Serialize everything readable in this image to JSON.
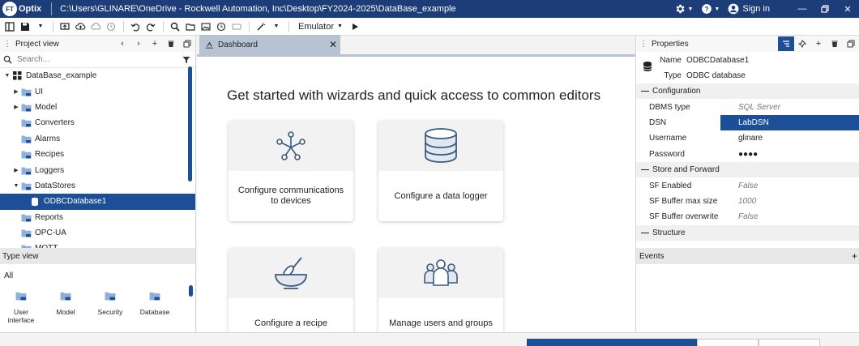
{
  "titlebar": {
    "logo_badge": "FT",
    "logo_text": "Optix",
    "path": "C:\\Users\\GLINARE\\OneDrive - Rockwell Automation, Inc\\Desktop\\FY2024-2025\\DataBase_example",
    "signin_label": "Sign in"
  },
  "toolbar": {
    "emulator_label": "Emulator"
  },
  "project_view": {
    "title": "Project view",
    "search_placeholder": "Search...",
    "items": [
      {
        "label": "DataBase_example",
        "level": 0,
        "arrow": "down"
      },
      {
        "label": "UI",
        "level": 1,
        "arrow": "right"
      },
      {
        "label": "Model",
        "level": 1,
        "arrow": "right"
      },
      {
        "label": "Converters",
        "level": 1,
        "arrow": ""
      },
      {
        "label": "Alarms",
        "level": 1,
        "arrow": ""
      },
      {
        "label": "Recipes",
        "level": 1,
        "arrow": ""
      },
      {
        "label": "Loggers",
        "level": 1,
        "arrow": "right"
      },
      {
        "label": "DataStores",
        "level": 1,
        "arrow": "down"
      },
      {
        "label": "ODBCDatabase1",
        "level": 2,
        "arrow": "",
        "selected": true
      },
      {
        "label": "Reports",
        "level": 1,
        "arrow": ""
      },
      {
        "label": "OPC-UA",
        "level": 1,
        "arrow": ""
      },
      {
        "label": "MQTT",
        "level": 1,
        "arrow": ""
      }
    ]
  },
  "type_view": {
    "title": "Type view",
    "filter_label": "All",
    "items": [
      {
        "label": "User interface"
      },
      {
        "label": "Model"
      },
      {
        "label": "Security"
      },
      {
        "label": "Database"
      }
    ]
  },
  "dashboard": {
    "tab_label": "Dashboard",
    "heading": "Get started with wizards and quick access to common editors",
    "cards": [
      {
        "label": "Configure communications to devices",
        "icon": "network-nodes-icon"
      },
      {
        "label": "Configure a data logger",
        "icon": "database-icon"
      },
      {
        "label": "Configure a recipe",
        "icon": "mixing-bowl-icon"
      },
      {
        "label": "Manage users and groups",
        "icon": "users-group-icon"
      }
    ]
  },
  "properties": {
    "title": "Properties",
    "name_key": "Name",
    "name_value": "ODBCDatabase1",
    "type_key": "Type",
    "type_value": "ODBC database",
    "sections": [
      {
        "title": "Configuration",
        "props": [
          {
            "key": "DBMS type",
            "value": "SQL Server",
            "style": "italic"
          },
          {
            "key": "DSN",
            "value": "LabDSN",
            "style": "selected"
          },
          {
            "key": "Username",
            "value": "glinare",
            "style": ""
          },
          {
            "key": "Password",
            "value": "●●●●",
            "style": ""
          }
        ]
      },
      {
        "title": "Store and Forward",
        "props": [
          {
            "key": "SF Enabled",
            "value": "False",
            "style": "italic"
          },
          {
            "key": "SF Buffer max size",
            "value": "1000",
            "style": "italic"
          },
          {
            "key": "SF Buffer overwrite",
            "value": "False",
            "style": "italic"
          }
        ]
      },
      {
        "title": "Structure",
        "props": []
      }
    ],
    "events_label": "Events"
  },
  "colors": {
    "titlebar": "#1c3d78",
    "accent": "#1c4f97",
    "tab": "#b7c3d3"
  }
}
